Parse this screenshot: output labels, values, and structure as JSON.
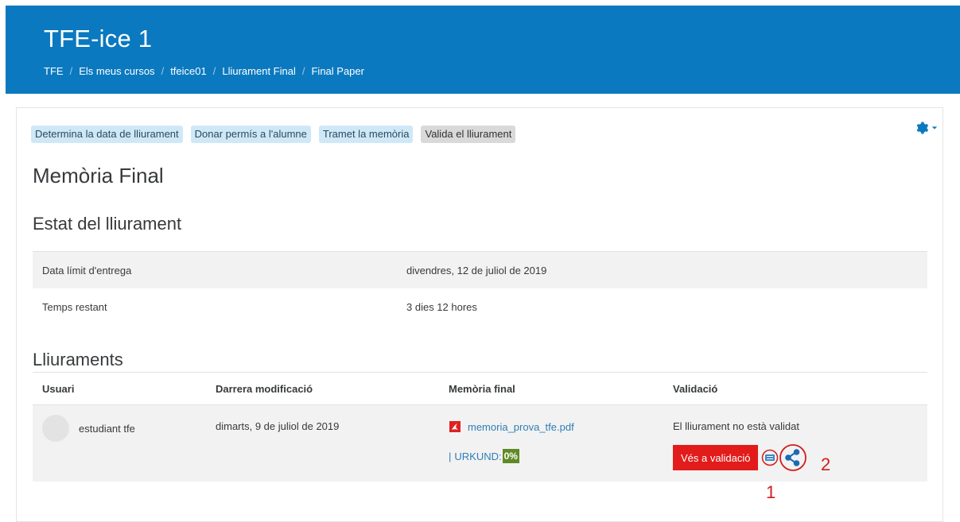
{
  "header": {
    "site_title": "TFE-ice 1",
    "breadcrumb": [
      "TFE",
      "Els meus cursos",
      "tfeice01",
      "Lliurament Final",
      "Final Paper"
    ]
  },
  "steps": [
    {
      "label": "Determina la data de lliurament",
      "state": "done"
    },
    {
      "label": "Donar permís a l'alumne",
      "state": "done"
    },
    {
      "label": "Tramet la memòria",
      "state": "done"
    },
    {
      "label": "Valida el lliurament",
      "state": "current"
    }
  ],
  "page_title": "Memòria Final",
  "status": {
    "heading": "Estat del lliurament",
    "rows": [
      {
        "label": "Data límit d'entrega",
        "value": "divendres, 12 de juliol de 2019"
      },
      {
        "label": "Temps restant",
        "value": "3 dies 12 hores"
      }
    ]
  },
  "submissions": {
    "heading": "Lliuraments",
    "columns": [
      "Usuari",
      "Darrera modificació",
      "Memòria final",
      "Validació"
    ],
    "row": {
      "user": "estudiant tfe",
      "modified": "dimarts, 9 de juliol de 2019",
      "file": "memoria_prova_tfe.pdf",
      "urkund_label": "URKUND:",
      "urkund_score": "0%",
      "validation_status": "El lliurament no està validat",
      "validate_button": "Vés a validació"
    }
  },
  "annotations": {
    "one": "1",
    "two": "2"
  },
  "colors": {
    "header_bg": "#0b79bf",
    "accent_red": "#e21b1b",
    "urkund_green": "#5f8a26",
    "link_blue": "#2d7fb8"
  },
  "icons": [
    "gear-icon",
    "pdf-icon",
    "list-icon",
    "share-icon"
  ]
}
